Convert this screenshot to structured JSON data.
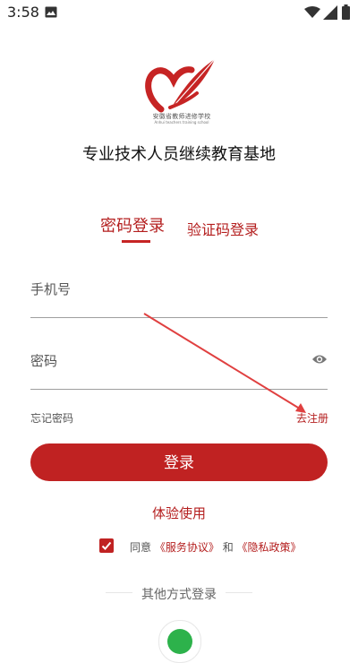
{
  "status_bar": {
    "time": "3:58"
  },
  "logo": {
    "seal_text": "安徽省教师进修学校",
    "seal_sub": "Anhui teachers training school"
  },
  "app_title": "专业技术人员继续教育基地",
  "tabs": {
    "password_login": "密码登录",
    "code_login": "验证码登录"
  },
  "form": {
    "phone_placeholder": "手机号",
    "password_placeholder": "密码"
  },
  "links": {
    "forgot_password": "忘记密码",
    "register": "去注册"
  },
  "buttons": {
    "login": "登录",
    "trial": "体验使用"
  },
  "agreement": {
    "agree": "同意",
    "service": "《服务协议》",
    "and": "和",
    "privacy": "《隐私政策》",
    "checked": true
  },
  "other_login_label": "其他方式登录",
  "colors": {
    "accent": "#c02222",
    "text_red": "#b41e1e",
    "wechat_green": "#2db24b"
  },
  "icons": [
    "image-icon",
    "wifi-icon",
    "signal-icon",
    "battery-icon",
    "eye-icon",
    "check-icon",
    "wechat-icon"
  ]
}
